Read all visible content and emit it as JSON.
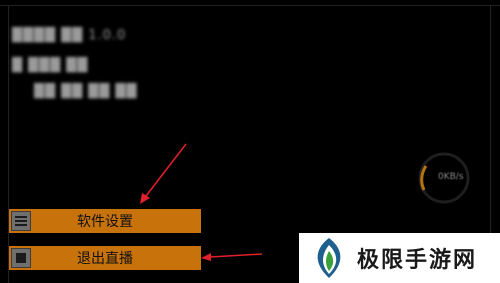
{
  "menu": {
    "settings_label": "软件设置",
    "exit_label": "退出直播"
  },
  "status": {
    "line1": "████ ██ 1.0.0",
    "line2": "█ ███ ██",
    "line3": "██ ██ ██ ██",
    "ring_value": "0KB/s"
  },
  "watermark": {
    "brand_text": "极限手游网"
  },
  "colors": {
    "button_fill": "#c8720c",
    "annotation_arrow": "#e0202a",
    "background": "#000000"
  },
  "icons": {
    "settings": "menu-lines-icon",
    "exit": "stop-square-icon"
  }
}
